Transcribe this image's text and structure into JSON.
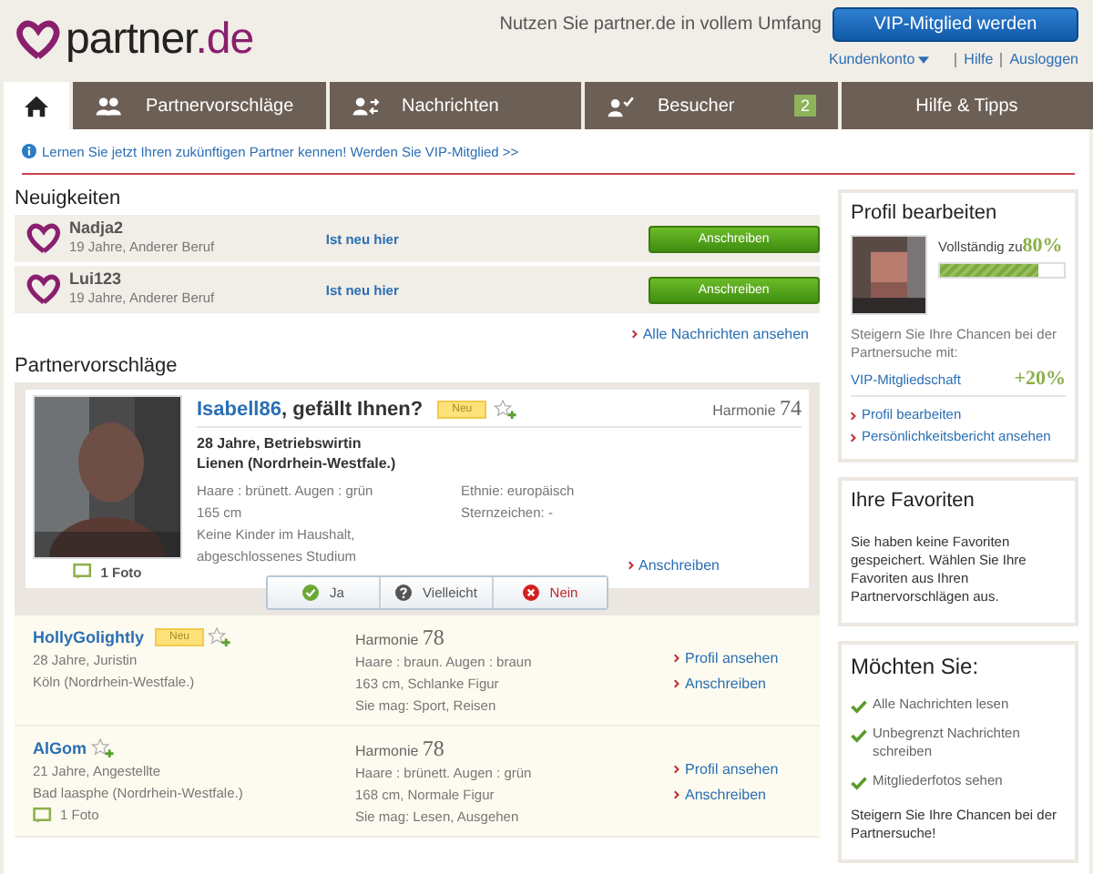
{
  "header": {
    "logo_main": "partner",
    "logo_suffix": ".de",
    "promo": "Nutzen Sie partner.de in vollem Umfang",
    "vip_button": "VIP-Mitglied werden",
    "account": "Kundenkonto",
    "links": [
      "Hilfe",
      "Ausloggen"
    ]
  },
  "tabs": [
    {
      "kind": "home",
      "selected": true
    },
    {
      "kind": "suggestions",
      "label": "Partnervorschläge",
      "selected": false
    },
    {
      "kind": "messages",
      "label": "Nachrichten",
      "selected": false
    },
    {
      "kind": "visitors",
      "label": "Besucher",
      "badge": "2",
      "selected": false
    },
    {
      "kind": "help",
      "label": "Hilfe & Tipps",
      "selected": false
    }
  ],
  "info_banner": "Lernen Sie jetzt Ihren zukünftigen Partner kennen! Werden Sie VIP-Mitglied >>",
  "news": {
    "title": "Neuigkeiten",
    "items": [
      {
        "name": "Nadja2",
        "details": "19 Jahre, Anderer Beruf",
        "status": "Ist neu hier",
        "action": "Anschreiben"
      },
      {
        "name": "Lui123",
        "details": "19 Jahre, Anderer Beruf",
        "status": "Ist neu hier",
        "action": "Anschreiben"
      }
    ],
    "more_link": "Alle Nachrichten ansehen"
  },
  "suggestions": {
    "title": "Partnervorschläge",
    "featured": {
      "name": "Isabell86",
      "question": ", gefällt Ihnen?",
      "badge": "Neu",
      "harmony_label": "Harmonie",
      "harmony": "74",
      "headline": [
        "28 Jahre, Betriebswirtin",
        "Lienen (Nordrhein-Westfale.)"
      ],
      "details_left": [
        "Haare : brünett. Augen : grün",
        "165 cm",
        "Keine Kinder im Haushalt, abgeschlossenes Studium"
      ],
      "details_right": [
        "Ethnie: europäisch",
        "Sternzeichen: -"
      ],
      "photos": "1 Foto",
      "action": "Anschreiben",
      "votes": [
        {
          "kind": "yes",
          "label": "Ja"
        },
        {
          "kind": "maybe",
          "label": "Vielleicht"
        },
        {
          "kind": "no",
          "label": "Nein"
        }
      ]
    },
    "items": [
      {
        "name": "HollyGolightly",
        "badge": "Neu",
        "lines": [
          "28 Jahre, Juristin",
          "Köln (Nordrhein-Westfale.)"
        ],
        "harmony_label": "Harmonie",
        "harmony": "78",
        "traits": [
          "Haare : braun. Augen : braun",
          "163 cm, Schlanke Figur",
          "Sie mag: Sport, Reisen"
        ],
        "links": [
          "Profil ansehen",
          "Anschreiben"
        ]
      },
      {
        "name": "AlGom",
        "lines": [
          "21 Jahre, Angestellte",
          "Bad laasphe (Nordrhein-Westfale.)"
        ],
        "photos": "1 Foto",
        "harmony_label": "Harmonie",
        "harmony": "78",
        "traits": [
          "Haare : brünett. Augen : grün",
          "168 cm, Normale Figur",
          "Sie mag: Lesen, Ausgehen"
        ],
        "links": [
          "Profil ansehen",
          "Anschreiben"
        ]
      }
    ]
  },
  "sidebar": {
    "profile": {
      "title": "Profil bearbeiten",
      "completeness_label": "Vollständig zu",
      "completeness": "80%",
      "level": 0.8,
      "text": "Steigern Sie Ihre Chancen bei der Partnersuche mit:",
      "vip_link": "VIP-Mitgliedschaft",
      "vip_bonus": "+20%",
      "links": [
        "Profil bearbeiten",
        "Persönlichkeitsbericht ansehen"
      ]
    },
    "favorites": {
      "title": "Ihre Favoriten",
      "text": "Sie haben keine Favoriten gespeichert. Wählen Sie Ihre Favoriten aus Ihren Partnervorschlägen aus."
    },
    "offer": {
      "title": "Möchten Sie:",
      "items": [
        "Alle Nachrichten lesen",
        "Unbegrenzt Nachrichten schreiben",
        "Mitgliederfotos sehen"
      ],
      "text": "Steigern Sie Ihre Chancen bei der Partnersuche!"
    }
  }
}
